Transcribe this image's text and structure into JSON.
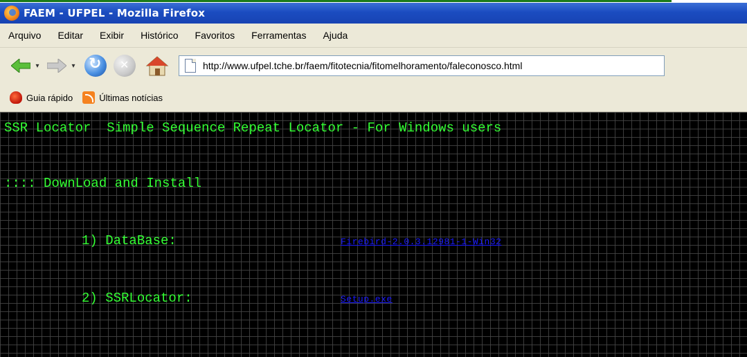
{
  "window": {
    "title": "FAEM - UFPEL - Mozilla Firefox"
  },
  "menu": [
    "Arquivo",
    "Editar",
    "Exibir",
    "Histórico",
    "Favoritos",
    "Ferramentas",
    "Ajuda"
  ],
  "toolbar": {
    "url": "http://www.ufpel.tche.br/faem/fitotecnia/fitomelhoramento/faleconosco.html"
  },
  "bookmarks": [
    {
      "label": "Guia rápido",
      "icon": "guide-icon"
    },
    {
      "label": "Últimas notícias",
      "icon": "rss-icon"
    }
  ],
  "page": {
    "heading": "SSR Locator  Simple Sequence Repeat Locator - For Windows users",
    "section": ":::: DownLoad and Install",
    "step1_label": "1) DataBase:",
    "step1_link": "Firebird-2.0.3.12981-1-Win32",
    "step2_label": "2) SSRLocator:",
    "step2_link": "Setup.exe"
  }
}
